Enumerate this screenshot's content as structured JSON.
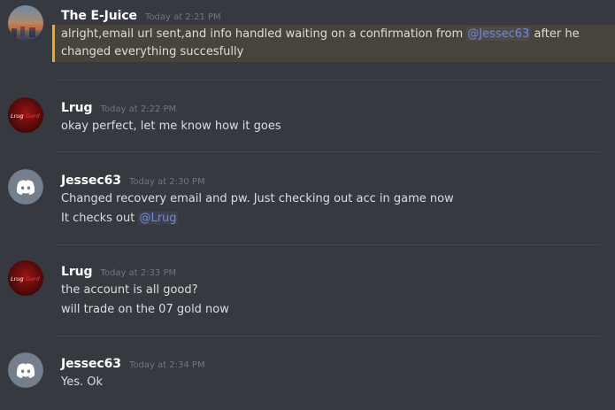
{
  "messages": [
    {
      "username": "The E-Juice",
      "timestamp": "Today at 2:21 PM",
      "avatar": "gradient-photo-avatar",
      "highlighted": true,
      "lines": [
        {
          "text": "alright,email url sent,and info handled waiting on a confirmation from ",
          "mention": "@Jessec63",
          "after": "  after he"
        },
        {
          "text": "changed everything succesfully"
        }
      ]
    },
    {
      "username": "Lrug",
      "timestamp": "Today at 2:22 PM",
      "avatar": "lrug-red-avatar",
      "avatar_text_a": "Lrug",
      "avatar_text_b": "Gord",
      "lines": [
        {
          "text": "okay perfect, let me know how it goes"
        }
      ]
    },
    {
      "username": "Jessec63",
      "timestamp": "Today at 2:30 PM",
      "avatar": "discord-default-avatar",
      "lines": [
        {
          "text": "Changed recovery email and pw. Just checking out acc in game now"
        },
        {
          "text": "It checks out ",
          "mention": "@Lrug"
        }
      ]
    },
    {
      "username": "Lrug",
      "timestamp": "Today at 2:33 PM",
      "avatar": "lrug-red-avatar",
      "avatar_text_a": "Lrug",
      "avatar_text_b": "Gord",
      "lines": [
        {
          "text": "the account is all good?"
        },
        {
          "text": "will trade on the 07 gold now"
        }
      ]
    },
    {
      "username": "Jessec63",
      "timestamp": "Today at 2:34 PM",
      "avatar": "discord-default-avatar",
      "lines": [
        {
          "text": "Yes. Ok"
        }
      ]
    }
  ],
  "colors": {
    "background": "#36393f",
    "username": "#ffffff",
    "timestamp": "#72767d",
    "text": "#dcddde",
    "mention": "#7289da",
    "highlight_border": "#faa61a",
    "discord_blurple": "#7289da"
  }
}
